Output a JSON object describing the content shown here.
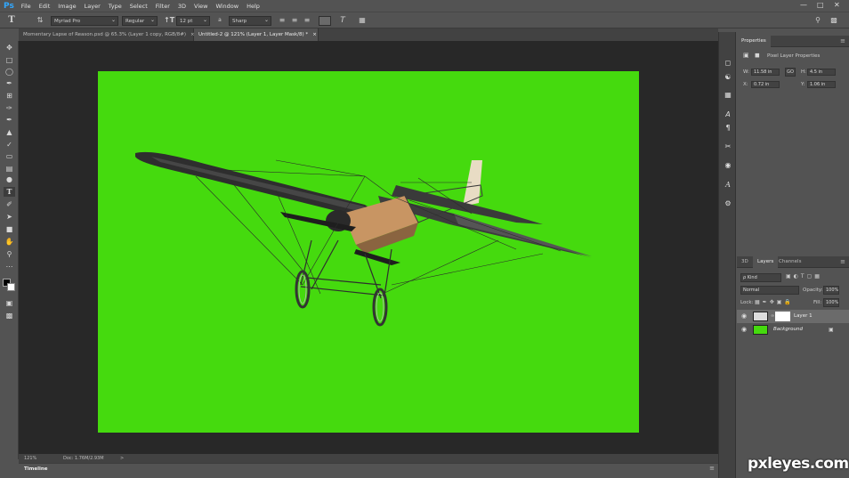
{
  "app": {
    "logo": "Ps"
  },
  "menu": [
    "File",
    "Edit",
    "Image",
    "Layer",
    "Type",
    "Select",
    "Filter",
    "3D",
    "View",
    "Window",
    "Help"
  ],
  "window_controls": {
    "minimize": "—",
    "maximize": "□",
    "close": "✕"
  },
  "options": {
    "font_family": "Myriad Pro",
    "font_style": "Regular",
    "font_size": "12 pt",
    "aa_label": "a",
    "antialias": "Sharp"
  },
  "tabs": [
    {
      "label": "Momentary Lapse of Reason.psd @ 65.3% (Layer 1 copy, RGB/8#)",
      "close": "×"
    },
    {
      "label": "Untitled-2 @ 121% (Layer 1, Layer Mask/8) *",
      "close": "×"
    }
  ],
  "status": {
    "zoom": "121%",
    "doc": "Doc: 1.76M/2.93M",
    "arrow": ">"
  },
  "timeline": {
    "label": "Timeline"
  },
  "properties": {
    "tab": "Properties",
    "heading": "Pixel Layer Properties",
    "w_label": "W:",
    "w_value": "11.58 in",
    "h_label": "H:",
    "h_value": "4.5 in",
    "x_label": "X:",
    "x_value": "0.72 in",
    "y_label": "Y:",
    "y_value": "1.06 in",
    "link": "GO"
  },
  "layers_panel": {
    "tabs": [
      "3D",
      "Layers",
      "Channels"
    ],
    "filter_kind": "ρ Kind",
    "blend_mode": "Normal",
    "opacity_label": "Opacity:",
    "opacity": "100%",
    "lock_label": "Lock:",
    "fill_label": "Fill:",
    "fill": "100%",
    "layers": [
      {
        "name": "Layer 1",
        "visible_icon": "◉"
      },
      {
        "name": "Background",
        "visible_icon": "◉"
      }
    ]
  },
  "colors": {
    "canvas": "#45da0e",
    "workspace": "#282828",
    "ui": "#535353"
  },
  "watermark": "pxleyes.com"
}
